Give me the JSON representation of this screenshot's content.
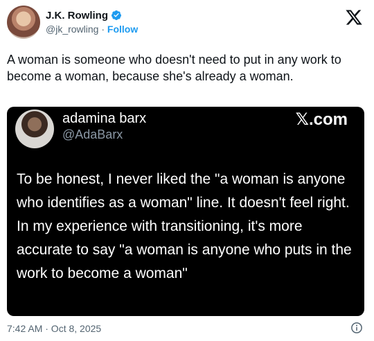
{
  "author": {
    "display_name": "J.K. Rowling",
    "handle": "@jk_rowling",
    "separator": " · ",
    "follow_label": "Follow"
  },
  "tweet": {
    "text": "A woman is someone who doesn't need to put in any work to become a woman, because she's already a woman."
  },
  "quote": {
    "display_name": "adamina barx",
    "handle": "@AdaBarx",
    "brand": "𝕏.com",
    "text": "To be honest, I never liked the \"a woman is anyone who identifies as a woman\" line. It doesn't feel right. In my experience with transitioning, it's more accurate to say \"a woman is anyone who puts in the work to become a woman\""
  },
  "meta": {
    "timestamp": "7:42 AM · Oct 8, 2025"
  },
  "icons": {
    "verified": "verified-badge-icon",
    "x_logo": "x-logo-icon",
    "info": "info-icon"
  },
  "colors": {
    "accent": "#1d9bf0",
    "muted": "#536471",
    "card_bg": "#000000"
  }
}
